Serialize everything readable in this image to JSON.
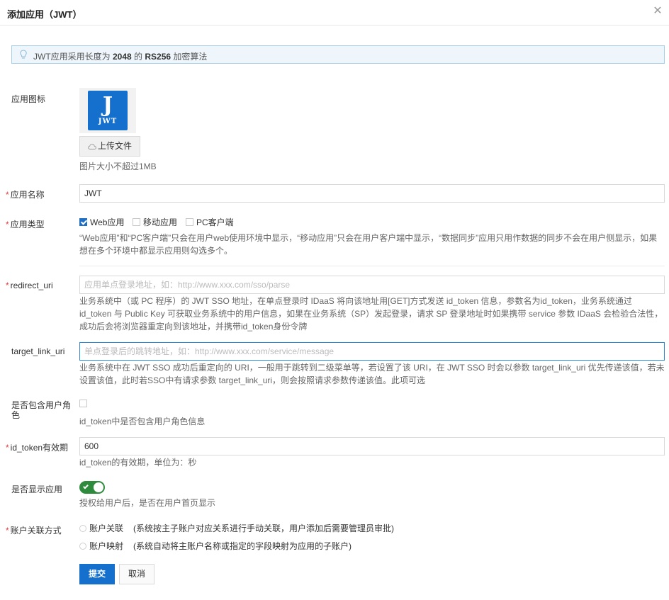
{
  "dialog": {
    "title": "添加应用（JWT）",
    "close_icon": "close-icon"
  },
  "notice": {
    "prefix": "JWT应用采用长度为 ",
    "length": "2048",
    "middle": " 的 ",
    "algorithm": "RS256",
    "suffix": " 加密算法"
  },
  "icon_field": {
    "label": "应用图标",
    "logo_main": "J",
    "logo_sub": "JWT",
    "upload_label": "上传文件",
    "help": "图片大小不超过1MB"
  },
  "name_field": {
    "label": "应用名称",
    "value": "JWT"
  },
  "type_field": {
    "label": "应用类型",
    "options": [
      {
        "label": "Web应用",
        "checked": true
      },
      {
        "label": "移动应用",
        "checked": false
      },
      {
        "label": "PC客户端",
        "checked": false
      }
    ],
    "help": "“Web应用”和“PC客户端”只会在用户web使用环境中显示，“移动应用”只会在用户客户端中显示，“数据同步”应用只用作数据的同步不会在用户侧显示，如果想在多个环境中都显示应用则勾选多个。"
  },
  "redirect_field": {
    "label": "redirect_uri",
    "placeholder": "应用单点登录地址，如：http://www.xxx.com/sso/parse",
    "value": "",
    "help": "业务系统中（或 PC 程序）的 JWT SSO 地址，在单点登录时 IDaaS 将向该地址用[GET]方式发送 id_token 信息，参数名为id_token，业务系统通过 id_token 与 Public Key 可获取业务系统中的用户信息，如果在业务系统（SP）发起登录，请求 SP 登录地址时如果携带 service 参数 IDaaS 会检验合法性，成功后会将浏览器重定向到该地址，并携带id_token身份令牌"
  },
  "target_field": {
    "label": "target_link_uri",
    "placeholder": "单点登录后的跳转地址，如：http://www.xxx.com/service/message",
    "value": "",
    "help": "业务系统中在 JWT SSO 成功后重定向的 URI，一般用于跳转到二级菜单等，若设置了该 URI，在 JWT SSO 时会以参数 target_link_uri 优先传递该值，若未设置该值，此时若SSO中有请求参数 target_link_uri，则会按照请求参数传递该值。此项可选"
  },
  "role_field": {
    "label": "是否包含用户角色",
    "checked": false,
    "help": "id_token中是否包含用户角色信息"
  },
  "expiry_field": {
    "label": "id_token有效期",
    "value": "600",
    "help": "id_token的有效期，单位为：秒"
  },
  "display_field": {
    "label": "是否显示应用",
    "enabled": true,
    "help": "授权给用户后，是否在用户首页显示"
  },
  "link_field": {
    "label": "账户关联方式",
    "options": [
      {
        "label": "账户关联",
        "desc": "(系统按主子账户对应关系进行手动关联，用户添加后需要管理员审批)",
        "selected": false
      },
      {
        "label": "账户映射",
        "desc": "(系统自动将主账户名称或指定的字段映射为应用的子账户)",
        "selected": false
      }
    ]
  },
  "actions": {
    "submit_label": "提交",
    "cancel_label": "取消"
  },
  "colors": {
    "primary": "#1470cc",
    "required": "#e4393c",
    "toggle_on": "#2e8b3d",
    "notice_bg": "#eef6fc"
  }
}
